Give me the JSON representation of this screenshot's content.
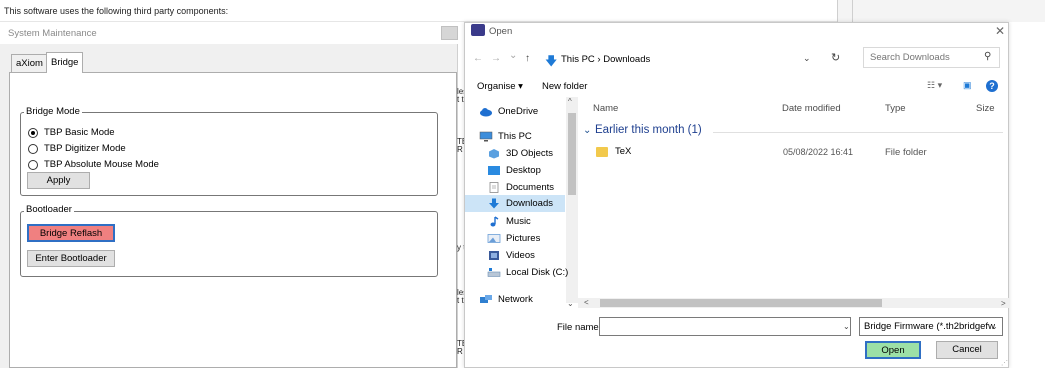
{
  "background": {
    "top_text": "This software uses the following third party components:",
    "fragments": [
      "les",
      "t th",
      "TEI",
      "R",
      "y t",
      "les",
      "t th",
      "TEI",
      "R"
    ]
  },
  "system_maintenance": {
    "title": "System Maintenance",
    "tabs": [
      {
        "label": "aXiom",
        "selected": false
      },
      {
        "label": "Bridge",
        "selected": true
      }
    ],
    "bridge_mode": {
      "legend": "Bridge Mode",
      "options": [
        {
          "label": "TBP Basic Mode",
          "checked": true
        },
        {
          "label": "TBP Digitizer Mode",
          "checked": false
        },
        {
          "label": "TBP Absolute Mouse Mode",
          "checked": false
        }
      ],
      "apply_label": "Apply"
    },
    "bootloader": {
      "legend": "Bootloader",
      "reflash_label": "Bridge Reflash",
      "enter_label": "Enter Bootloader"
    }
  },
  "open_dialog": {
    "title": "Open",
    "close_glyph": "✕",
    "nav": {
      "back": "←",
      "forward": "→",
      "recent": "⌄",
      "up": "↑"
    },
    "address": "This PC  ›  Downloads",
    "search": {
      "placeholder": "Search Downloads"
    },
    "toolbar": {
      "organise": "Organise ▾",
      "new_folder": "New folder",
      "help": "?"
    },
    "nav_pane": [
      {
        "label": "OneDrive",
        "icon": "cloud-icon",
        "color": "#1e6fd0"
      },
      {
        "label": "This PC",
        "icon": "computer-icon",
        "color": "#3c8ddb"
      },
      {
        "label": "3D Objects",
        "icon": "cube-icon",
        "color": "#5aa0e0"
      },
      {
        "label": "Desktop",
        "icon": "desktop-icon",
        "color": "#2a8ae0"
      },
      {
        "label": "Documents",
        "icon": "document-icon",
        "color": "#8a8a8a"
      },
      {
        "label": "Downloads",
        "icon": "download-icon",
        "color": "#1e7ad6",
        "selected": true
      },
      {
        "label": "Music",
        "icon": "music-icon",
        "color": "#1e6fd0"
      },
      {
        "label": "Pictures",
        "icon": "picture-icon",
        "color": "#6a9ed8"
      },
      {
        "label": "Videos",
        "icon": "video-icon",
        "color": "#3a5a9a"
      },
      {
        "label": "Local Disk (C:)",
        "icon": "drive-icon",
        "color": "#6d8fb3"
      },
      {
        "label": "Network",
        "icon": "network-icon",
        "color": "#2f7fd0"
      }
    ],
    "columns": {
      "name": "Name",
      "date": "Date modified",
      "type": "Type",
      "size": "Size"
    },
    "group": {
      "label": "Earlier this month (1)"
    },
    "files": [
      {
        "name": "TeX",
        "date": "05/08/2022 16:41",
        "type": "File folder",
        "icon_color": "#f2c94c"
      }
    ],
    "filename_label": "File name:",
    "filename_value": "",
    "filter_value": "Bridge Firmware (*.th2bridgefw",
    "open_label": "Open",
    "cancel_label": "Cancel"
  }
}
